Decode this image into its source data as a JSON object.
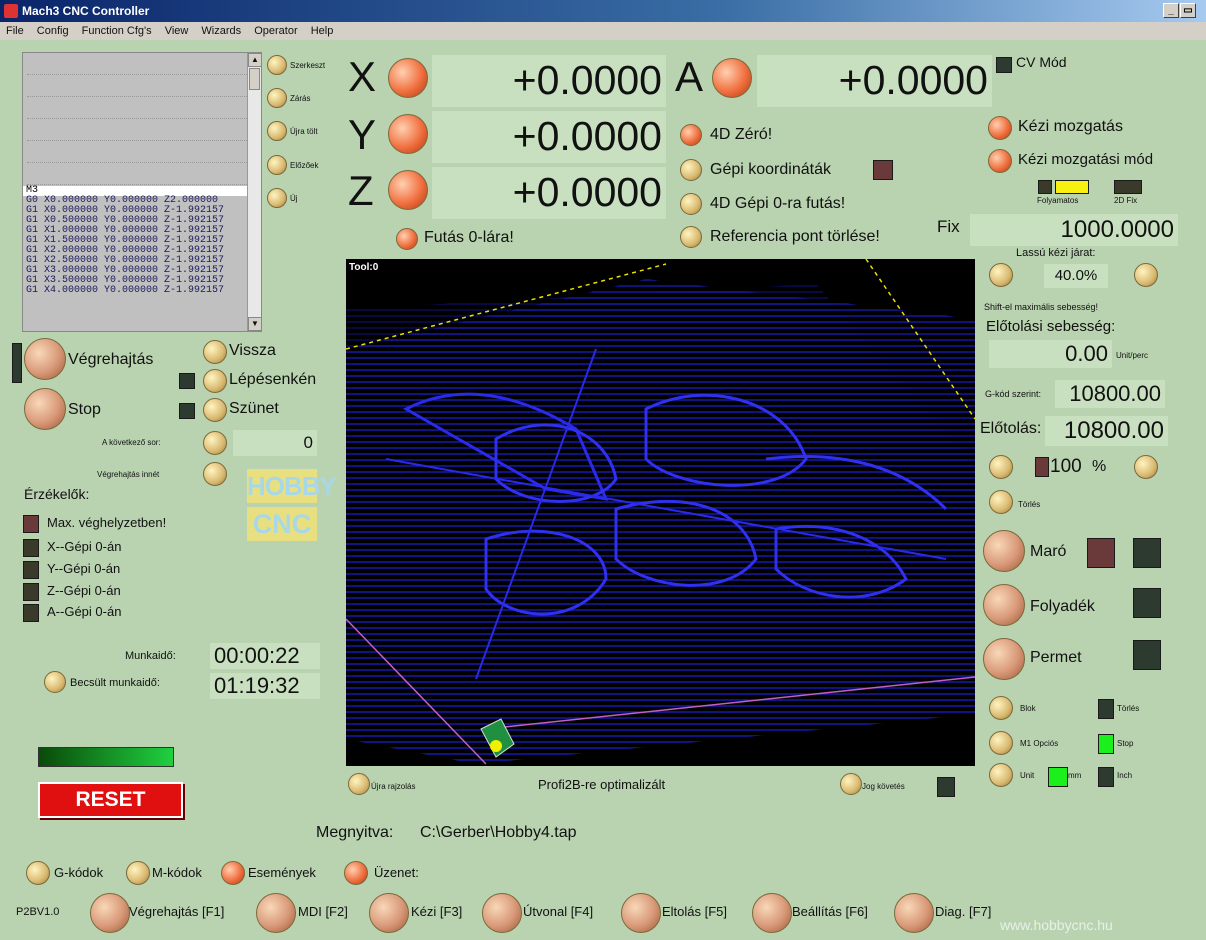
{
  "window": {
    "title": "Mach3 CNC Controller",
    "controls": [
      "_",
      "×"
    ]
  },
  "menu": [
    "File",
    "Config",
    "Function Cfg's",
    "View",
    "Wizards",
    "Operator",
    "Help"
  ],
  "gcode": {
    "lines": [
      "M3",
      "G0 X0.000000 Y0.000000 Z2.000000",
      "G1 X0.000000 Y0.000000 Z-1.992157",
      "G1 X0.500000 Y0.000000 Z-1.992157",
      "G1 X1.000000 Y0.000000 Z-1.992157",
      "G1 X1.500000 Y0.000000 Z-1.992157",
      "G1 X2.000000 Y0.000000 Z-1.992157",
      "G1 X2.500000 Y0.000000 Z-1.992157",
      "G1 X3.000000 Y0.000000 Z-1.992157",
      "G1 X3.500000 Y0.000000 Z-1.992157",
      "G1 X4.000000 Y0.000000 Z-1.992157"
    ]
  },
  "file_buttons": [
    "Szerkeszt",
    "Zárás",
    "Újra tölt",
    "Előzőek",
    "Új"
  ],
  "dro": {
    "x": {
      "label": "X",
      "value": "+0.0000"
    },
    "y": {
      "label": "Y",
      "value": "+0.0000"
    },
    "z": {
      "label": "Z",
      "value": "+0.0000"
    },
    "a": {
      "label": "A",
      "value": "+0.0000"
    }
  },
  "dro_buttons": {
    "zero4d": "4D Zéró!",
    "machine_coords": "Gépi koordináták",
    "goto_machine_zero": "4D Gépi 0-ra futás!",
    "ref_clear": "Referencia pont törlése!",
    "goto_zero": "Futás 0-lára!"
  },
  "cv_mode": "CV Mód",
  "jog": {
    "manual": "Kézi mozgatás",
    "manual_mode": "Kézi mozgatási mód",
    "continuous": "Folyamatos",
    "fix2d": "2D Fix",
    "fix_label": "Fix",
    "fix_value": "1000.0000",
    "slow_label": "Lassú kézi járat:",
    "slow_value": "40.0%",
    "shift_note": "Shift-el maximális sebesség!"
  },
  "feed": {
    "title": "Előtolási sebesség:",
    "units_value": "0.00",
    "units_label": "Unit/perc",
    "gcode_label": "G-kód szerint:",
    "gcode_value": "10800.00",
    "feed_label": "Előtolás:",
    "feed_value": "10800.00",
    "override": "100",
    "percent": "%",
    "reset": "Törlés"
  },
  "spindle": {
    "mill": "Maró",
    "flood": "Folyadék",
    "mist": "Permet"
  },
  "options": {
    "block": "Blok",
    "block_clear": "Törlés",
    "m1": "M1 Opciós",
    "m1_stop": "Stop",
    "unit": "Unit",
    "mm": "mm",
    "inch": "Inch"
  },
  "program": {
    "run": "Végrehajtás",
    "back": "Vissza",
    "step": "Lépésenkén",
    "stop": "Stop",
    "pause": "Szünet",
    "next_line_label": "A következő sor:",
    "next_line_value": "0",
    "run_from": "Végrehajtás innét"
  },
  "sensors": {
    "title": "Érzékelők:",
    "items": [
      "Max. véghelyzetben!",
      "X--Gépi 0-án",
      "Y--Gépi 0-án",
      "Z--Gépi 0-án",
      "A--Gépi 0-án"
    ]
  },
  "times": {
    "work_label": "Munkaidő:",
    "work_value": "00:00:22",
    "est_label": "Becsült munkaidő:",
    "est_value": "01:19:32"
  },
  "logo": {
    "line1": "HOBBY",
    "line2": "CNC"
  },
  "reset_label": "RESET",
  "toolpath": {
    "tool_label": "Tool:0"
  },
  "redraw": "Újra rajzolás",
  "optimized": "Profi2B-re optimalizált",
  "jog_follow": "Jog követés",
  "opened": {
    "label": "Megnyitva:",
    "file": "C:\\Gerber\\Hobby4.tap"
  },
  "bottom_toggles": [
    "G-kódok",
    "M-kódok",
    "Események",
    "Üzenet:"
  ],
  "version": "P2BV1.0",
  "tabs": [
    "Végrehajtás [F1]",
    "MDI [F2]",
    "Kézi [F3]",
    "Útvonal [F4]",
    "Eltolás [F5]",
    "Beállítás [F6]",
    "Diag. [F7]"
  ],
  "website": "www.hobbycnc.hu",
  "colors": {
    "background": "#b9d3b0",
    "reset": "#e01010",
    "toolpath_line": "#1a1ad0"
  }
}
